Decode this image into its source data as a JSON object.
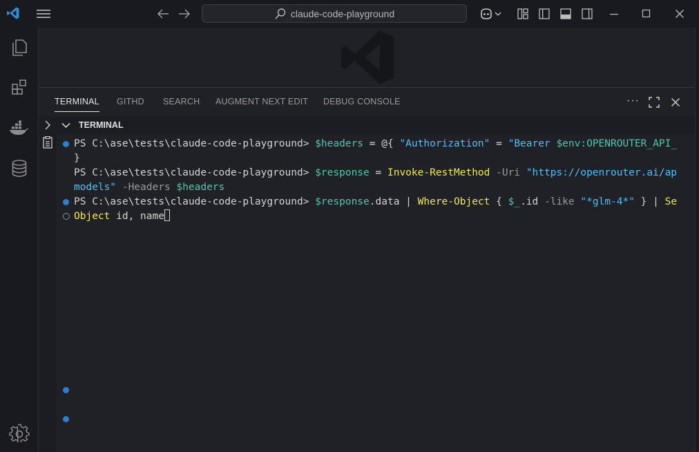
{
  "titlebar": {
    "search_text": "claude-code-playground"
  },
  "panel": {
    "tabs": [
      {
        "label": "TERMINAL"
      },
      {
        "label": "GITHD"
      },
      {
        "label": "SEARCH"
      },
      {
        "label": "AUGMENT NEXT EDIT"
      },
      {
        "label": "DEBUG CONSOLE"
      }
    ],
    "more_actions": "···",
    "section_title": "TERMINAL"
  },
  "terminal": {
    "line1": {
      "prompt": "PS C:\\ase\\tests\\claude-code-playground> ",
      "var": "$headers",
      "op1": " = @{ ",
      "key": "\"Authorization\"",
      "op2": " = ",
      "val_a": "\"Bearer ",
      "val_b": "$env:OPENROUTER_API_"
    },
    "line2": "}",
    "line3": {
      "prompt": "PS C:\\ase\\tests\\claude-code-playground> ",
      "var": "$response",
      "op": " = ",
      "cmd": "Invoke-RestMethod",
      "param": " -Uri ",
      "url": "\"https://openrouter.ai/ap"
    },
    "line4": {
      "url_end": "models\"",
      "param": " -Headers ",
      "var": "$headers"
    },
    "line5": {
      "prompt": "PS C:\\ase\\tests\\claude-code-playground> ",
      "var": "$response",
      "prop": ".data | ",
      "cmd": "Where-Object",
      "op1": " { ",
      "var2": "$_",
      "prop2": ".id ",
      "param": "-like ",
      "str": "\"*glm-4*\"",
      "op2": " } | ",
      "cmd2": "Se"
    },
    "line6": {
      "cmd": "Object",
      "rest": " id, name"
    }
  },
  "colors": {
    "accent": "#2b7fd0",
    "background": "#1f2126",
    "command": "#f5e94e",
    "variable": "#4ec9b0",
    "string": "#4fc1ff"
  }
}
